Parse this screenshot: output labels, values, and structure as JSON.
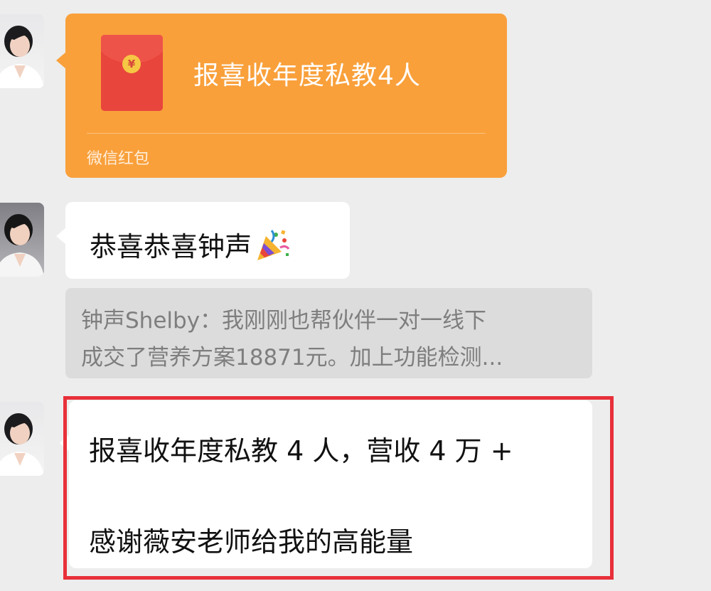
{
  "messages": [
    {
      "type": "red_packet",
      "title": "报喜收年度私教4人",
      "footer": "微信红包",
      "coin_symbol": "¥"
    },
    {
      "type": "text",
      "text": "恭喜恭喜钟声",
      "emoji": "party-popper-icon"
    },
    {
      "type": "quote",
      "line1": "钟声Shelby：我刚刚也帮伙伴一对一线下",
      "line2": "成交了营养方案18871元。加上功能检测..."
    },
    {
      "type": "text",
      "line1": "报喜收年度私教 4 人，营收 4 万 +",
      "line2": "感谢薇安老师给我的高能量",
      "highlighted": true
    }
  ],
  "colors": {
    "background": "#ededed",
    "red_packet": "#f9a03b",
    "envelope": "#e8453c",
    "bubble": "#ffffff",
    "quote_bg": "#dcdcdc",
    "highlight_border": "#e8303a"
  }
}
